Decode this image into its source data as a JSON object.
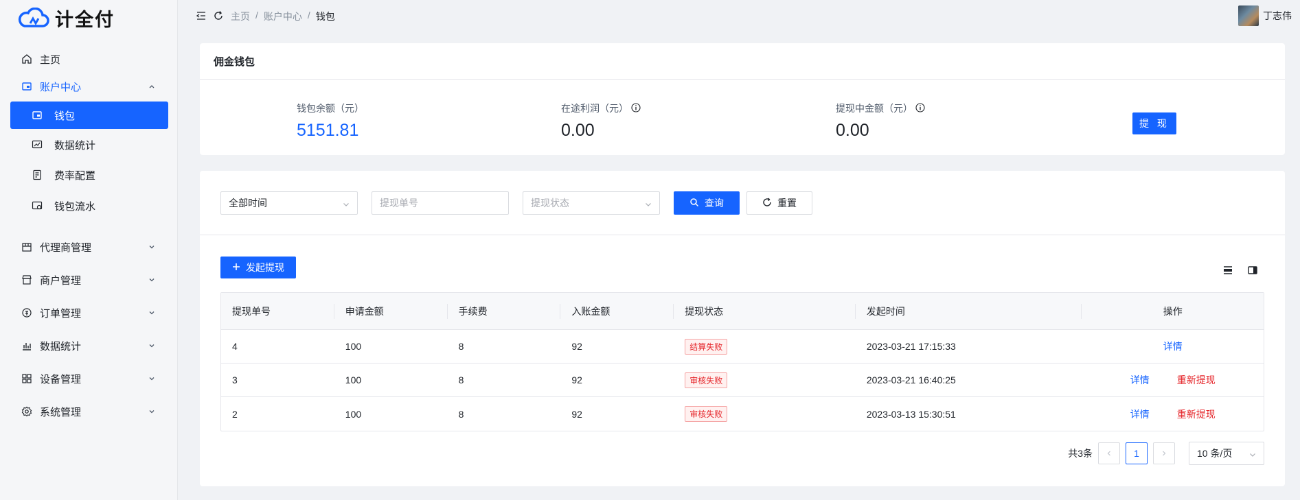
{
  "app": {
    "name": "计全付"
  },
  "sidebar": {
    "items": [
      {
        "label": "主页",
        "icon": "home-icon"
      },
      {
        "label": "账户中心",
        "icon": "wallet-icon",
        "expanded": true,
        "children": [
          {
            "label": "钱包",
            "icon": "wallet-icon",
            "selected": true
          },
          {
            "label": "数据统计",
            "icon": "stats-icon"
          },
          {
            "label": "费率配置",
            "icon": "rate-config-icon"
          },
          {
            "label": "钱包流水",
            "icon": "flow-icon"
          }
        ]
      },
      {
        "label": "代理商管理",
        "icon": "agent-icon"
      },
      {
        "label": "商户管理",
        "icon": "merchant-icon"
      },
      {
        "label": "订单管理",
        "icon": "order-icon"
      },
      {
        "label": "数据统计",
        "icon": "bar-chart-icon"
      },
      {
        "label": "设备管理",
        "icon": "grid-icon"
      },
      {
        "label": "系统管理",
        "icon": "gear-icon"
      }
    ]
  },
  "topbar": {
    "breadcrumb": [
      "主页",
      "/",
      "账户中心",
      "/",
      "钱包"
    ],
    "user": "丁志伟"
  },
  "wallet": {
    "title": "佣金钱包",
    "balance_label": "钱包余额（元）",
    "balance": "5151.81",
    "transit_label": "在途利润（元）",
    "transit": "0.00",
    "pending_label": "提现中金额（元）",
    "pending": "0.00",
    "withdraw_button": "提 现"
  },
  "filters": {
    "time": "全部时间",
    "order_placeholder": "提现单号",
    "status_placeholder": "提现状态",
    "query_button": "查询",
    "reset_button": "重置"
  },
  "actions": {
    "add_button": "发起提现"
  },
  "table": {
    "headers": [
      "提现单号",
      "申请金额",
      "手续费",
      "入账金额",
      "提现状态",
      "发起时间",
      "操作"
    ],
    "rows": [
      {
        "id": "4",
        "amount": "100",
        "fee": "8",
        "net": "92",
        "status": "结算失败",
        "time": "2023-03-21 17:15:33",
        "detail": "详情",
        "retry": ""
      },
      {
        "id": "3",
        "amount": "100",
        "fee": "8",
        "net": "92",
        "status": "审核失败",
        "time": "2023-03-21 16:40:25",
        "detail": "详情",
        "retry": "重新提现"
      },
      {
        "id": "2",
        "amount": "100",
        "fee": "8",
        "net": "92",
        "status": "审核失败",
        "time": "2023-03-13 15:30:51",
        "detail": "详情",
        "retry": "重新提现"
      }
    ]
  },
  "pagination": {
    "total": "共3条",
    "current": "1",
    "page_size": "10 条/页"
  },
  "colors": {
    "primary": "#1664ff",
    "danger": "#e5252a"
  }
}
